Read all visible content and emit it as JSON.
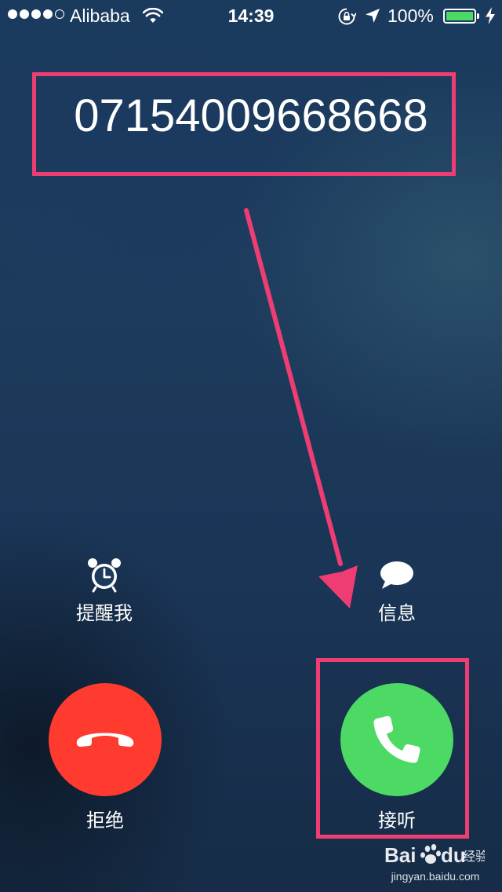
{
  "status_bar": {
    "signal_bars_filled": 4,
    "signal_bars_total": 5,
    "carrier": "Alibaba",
    "time": "14:39",
    "battery_percent": "100%",
    "battery_level": 1.0,
    "icons": [
      "wifi-icon",
      "rotation-lock-icon",
      "location-icon",
      "battery-icon",
      "charging-icon"
    ]
  },
  "caller": {
    "number": "07154009668668"
  },
  "actions": {
    "remind_me": {
      "label": "提醒我",
      "icon": "alarm-clock-icon"
    },
    "message": {
      "label": "信息",
      "icon": "speech-bubble-icon"
    },
    "decline": {
      "label": "拒绝",
      "icon": "phone-hangup-icon"
    },
    "accept": {
      "label": "接听",
      "icon": "phone-icon"
    }
  },
  "colors": {
    "decline": "#ff3b30",
    "accept": "#4cd964",
    "annotation": "#ee3d72",
    "battery": "#4cd964"
  },
  "watermark": {
    "brand": "Bai du 经验",
    "url": "jingyan.baidu.com"
  }
}
